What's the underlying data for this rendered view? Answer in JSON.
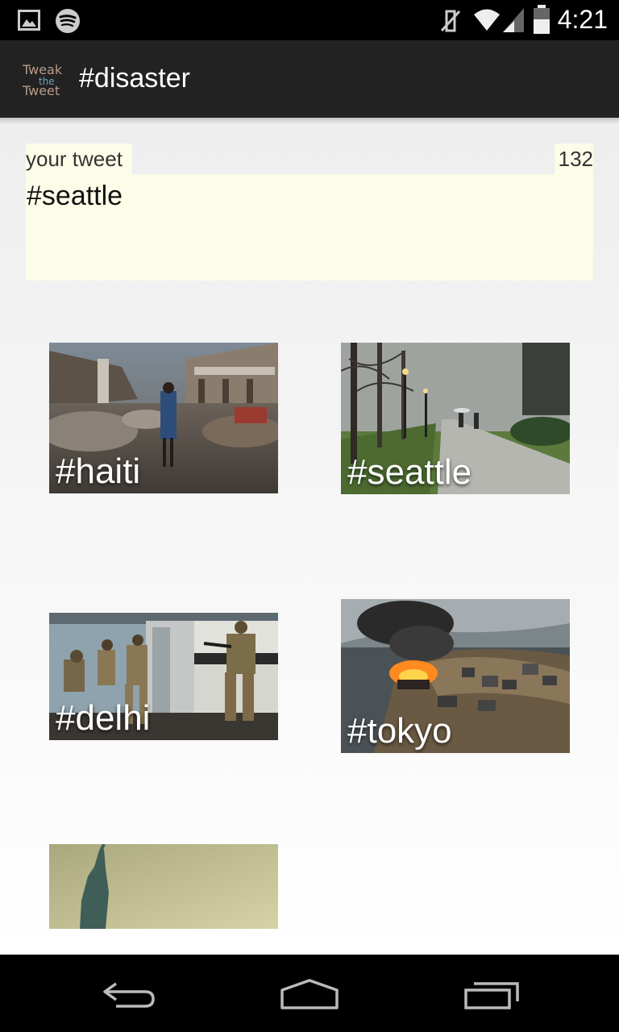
{
  "status_bar": {
    "time": "4:21"
  },
  "app": {
    "title": "#disaster",
    "logo_icon": "tweak-the-tweet-logo"
  },
  "composer": {
    "label": "your tweet",
    "remaining_chars": "132",
    "text": "#seattle"
  },
  "tiles": [
    {
      "label": "#haiti"
    },
    {
      "label": "#seattle"
    },
    {
      "label": "#delhi"
    },
    {
      "label": "#tokyo"
    },
    {
      "label": ""
    }
  ],
  "nav_bar": {
    "icons": [
      "back-icon",
      "home-icon",
      "recent-apps-icon"
    ]
  },
  "colors": {
    "composer_bg": "#fcfce8",
    "action_bar": "#222222"
  }
}
